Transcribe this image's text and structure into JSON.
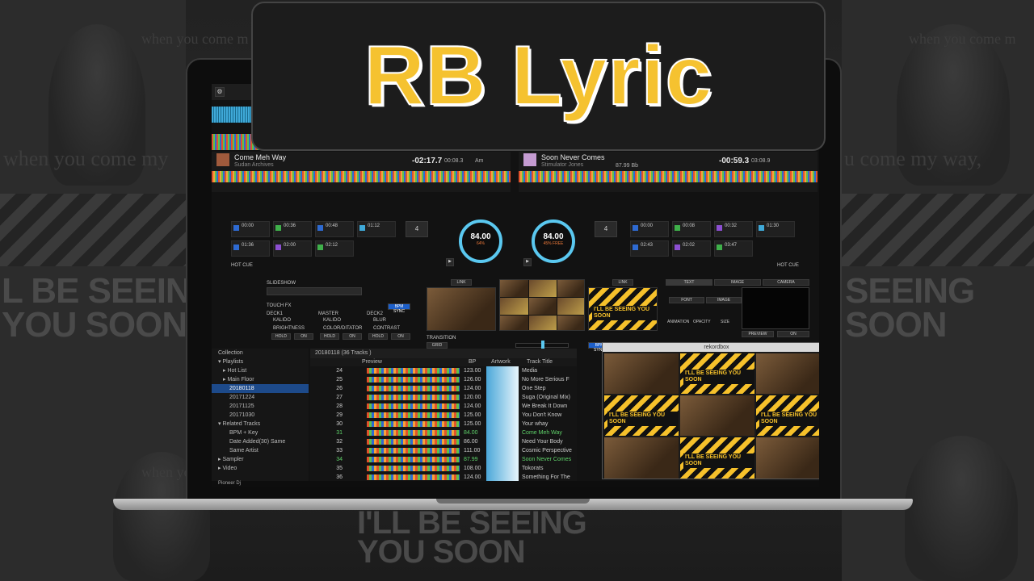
{
  "overlay": {
    "title": "RB Lyric"
  },
  "background": {
    "ghost_lyric_top": "when you come m",
    "ghost_lyric_mid_left": "when you come my",
    "ghost_lyric_mid_right": "u come my way,",
    "ghost_lyric_bottom": "when you com",
    "ghost_poster_left": "L BE SEEING\nYOU SOON",
    "ghost_poster_right": "SEEING\nSOON",
    "ghost_poster_bottom": "I'LL BE SEEING\nYOU SOON"
  },
  "deck1": {
    "title": "Come Meh Way",
    "artist": "Sudan Archives",
    "time_remaining": "-02:17.7",
    "time_elapsed": "00:08.3",
    "bpm": "84.00",
    "key": "Am",
    "bpm_pct": "64%",
    "hot_cue_label": "HOT CUE",
    "hot_cues": [
      {
        "time": "00:00",
        "color": "#2e6ad1"
      },
      {
        "time": "00:36",
        "color": "#3fb04a"
      },
      {
        "time": "00:48",
        "color": "#2e6ad1"
      },
      {
        "time": "01:12",
        "color": "#3fa9d8"
      },
      {
        "time": "01:36",
        "color": "#2e6ad1"
      },
      {
        "time": "02:00",
        "color": "#8c4fd1"
      },
      {
        "time": "02:12",
        "color": "#3fb04a"
      }
    ]
  },
  "deck2": {
    "title": "Soon Never Comes",
    "artist": "Stimulator Jones",
    "bpm_header": "87.99 Bb",
    "time_remaining": "-00:59.3",
    "time_elapsed": "03:08.9",
    "bpm": "84.00",
    "bpm_pct": "45%",
    "bpm_tag": "FREE",
    "hot_cue_label": "HOT CUE",
    "hot_cues": [
      {
        "time": "00:00",
        "color": "#2e6ad1"
      },
      {
        "time": "00:08",
        "color": "#3fb04a"
      },
      {
        "time": "00:32",
        "color": "#8c4fd1"
      },
      {
        "time": "01:30",
        "color": "#3fa9d8"
      },
      {
        "time": "02:43",
        "color": "#2e6ad1"
      },
      {
        "time": "02:02",
        "color": "#8c4fd1"
      },
      {
        "time": "03:47",
        "color": "#3fb04a"
      }
    ]
  },
  "deck_common": {
    "beat_count": "4",
    "sync_label": "REV SYNC",
    "master_label": "MASTER"
  },
  "fx": {
    "slideshow_label": "SLIDESHOW",
    "touch_fx_label": "TOUCH FX",
    "col1_header": "DECK1",
    "col2_header": "MASTER",
    "col3_header": "DECK2",
    "fx1": "KALIDO",
    "fx2": "KALIDO",
    "fx3": "BLUR",
    "fx4": "BRIGHTNESS",
    "fx5": "COLOR/DITATOR",
    "fx6": "CONTRAST",
    "hold": "HOLD",
    "on": "ON",
    "bpm_sync": "BPM SYNC",
    "link": "LINK",
    "transition_label": "TRANSITION",
    "transition_value": "GRID",
    "transition_sync": "BPM SYNC"
  },
  "right_panel": {
    "tabs": [
      "TEXT",
      "IMAGE",
      "CAMERA"
    ],
    "font": "FONT",
    "image": "IMAGE",
    "animation": "ANIMATION",
    "opacity": "OPACITY",
    "size": "SIZE",
    "preview": "PREVIEW",
    "on": "ON"
  },
  "video": {
    "poster_text": "I'LL BE SEEING YOU SOON"
  },
  "sidebar": {
    "items": [
      {
        "label": "Collection",
        "selected": false
      },
      {
        "label": "▾ Playlists",
        "selected": false
      },
      {
        "label": "▸ Hot List",
        "selected": false
      },
      {
        "label": "▸ Main Floor",
        "selected": false
      },
      {
        "label": "20180118",
        "selected": true
      },
      {
        "label": "20171224",
        "selected": false
      },
      {
        "label": "20171125",
        "selected": false
      },
      {
        "label": "20171030",
        "selected": false
      },
      {
        "label": "▾ Related Tracks",
        "selected": false
      },
      {
        "label": "BPM + Key",
        "selected": false
      },
      {
        "label": "Date Added(30) Same",
        "selected": false
      },
      {
        "label": "Same Artist",
        "selected": false
      },
      {
        "label": "▸ Sampler",
        "selected": false
      },
      {
        "label": "▸ Video",
        "selected": false
      }
    ]
  },
  "tracklist": {
    "header": "20180118 (36 Tracks )",
    "columns": {
      "preview": "Preview",
      "bpm": "BP",
      "artwork": "Artwork",
      "track": "Track Title"
    },
    "rows": [
      {
        "num": "24",
        "bpm": "123.00",
        "title": "Media",
        "highlight": false
      },
      {
        "num": "25",
        "bpm": "126.00",
        "title": "No More Serious F",
        "highlight": false
      },
      {
        "num": "26",
        "bpm": "124.00",
        "title": "One Step",
        "highlight": false
      },
      {
        "num": "27",
        "bpm": "120.00",
        "title": "Suga (Original Mix)",
        "highlight": false
      },
      {
        "num": "28",
        "bpm": "124.00",
        "title": "We Break It Down",
        "highlight": false
      },
      {
        "num": "29",
        "bpm": "125.00",
        "title": "You Don't Know",
        "highlight": false
      },
      {
        "num": "30",
        "bpm": "125.00",
        "title": "Your whay",
        "highlight": false
      },
      {
        "num": "31",
        "bpm": "84.00",
        "title": "Come Meh Way",
        "highlight": true
      },
      {
        "num": "32",
        "bpm": "86.00",
        "title": "Need Your Body",
        "highlight": false
      },
      {
        "num": "33",
        "bpm": "111.00",
        "title": "Cosmic Perspective",
        "highlight": false
      },
      {
        "num": "34",
        "bpm": "87.99",
        "title": "Soon Never Comes",
        "highlight": true
      },
      {
        "num": "35",
        "bpm": "108.00",
        "title": "Tokorats",
        "highlight": false
      },
      {
        "num": "36",
        "bpm": "124.00",
        "title": "Something For The",
        "highlight": false
      }
    ]
  },
  "kuvo_window": {
    "title": "rekordbox"
  },
  "footer": {
    "brand": "Pioneer Dj"
  }
}
